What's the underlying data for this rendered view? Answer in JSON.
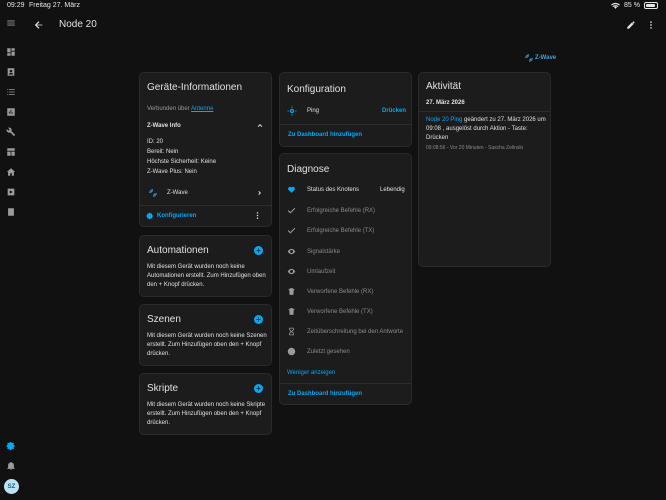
{
  "status_bar": {
    "time": "09:29",
    "date": "Freitag 27. März",
    "battery": "85 %",
    "battery_level": 0.85
  },
  "header": {
    "title": "Node 20"
  },
  "zwave_logo_text": "Z-Wave",
  "device_info": {
    "title": "Geräte-Informationen",
    "connected_via_prefix": "Verbunden über",
    "connected_via_link": "Antenne",
    "zwave_info_header": "Z-Wave Info",
    "id": "ID: 20",
    "ready": "Bereit: Nein",
    "security": "Höchste Sicherheit: Keine",
    "plus": "Z-Wave Plus: Nein",
    "integration": "Z-Wave",
    "configure": "Konfigurieren"
  },
  "automations": {
    "title": "Automationen",
    "text": "Mit diesem Gerät wurden noch keine Automationen erstellt. Zum Hinzufügen oben den + Knopf drücken."
  },
  "scenes": {
    "title": "Szenen",
    "text": "Mit diesem Gerät wurden noch keine Szenen erstellt. Zum Hinzufügen oben den + Knopf drücken."
  },
  "scripts": {
    "title": "Skripte",
    "text": "Mit diesem Gerät wurden noch keine Skripte erstellt. Zum Hinzufügen oben den + Knopf drücken."
  },
  "configuration": {
    "title": "Konfiguration",
    "ping_label": "Ping",
    "ping_button": "Drücken",
    "add_dashboard": "Zu Dashboard hinzufügen"
  },
  "diagnostics": {
    "title": "Diagnose",
    "node_status_label": "Status des Knotens",
    "node_status_value": "Lebendig",
    "rows": [
      "Erfolgreiche Befehle (RX)",
      "Erfolgreiche Befehle (TX)",
      "Signalstärke",
      "Umlaufzeit",
      "Verworfene Befehle (RX)",
      "Verworfene Befehle (TX)",
      "Zeitüberschreitung bei den Antworte",
      "Zuletzt gesehen"
    ],
    "show_more": "Weniger anzeigen",
    "add_dashboard": "Zu Dashboard hinzufügen"
  },
  "activity": {
    "title": "Aktivität",
    "date": "27. März 2026",
    "entity_link": "Node 20 Ping",
    "entry_text": "geändert zu 27. März 2026 um 09:08 , ausgelöst durch Aktion - Taste: Drücken",
    "entry_meta": "09:08:56 - Vor 20 Minuten - Sascha Zelinski"
  },
  "user": {
    "initials": "SZ"
  },
  "accent_color": "#03a9f4"
}
